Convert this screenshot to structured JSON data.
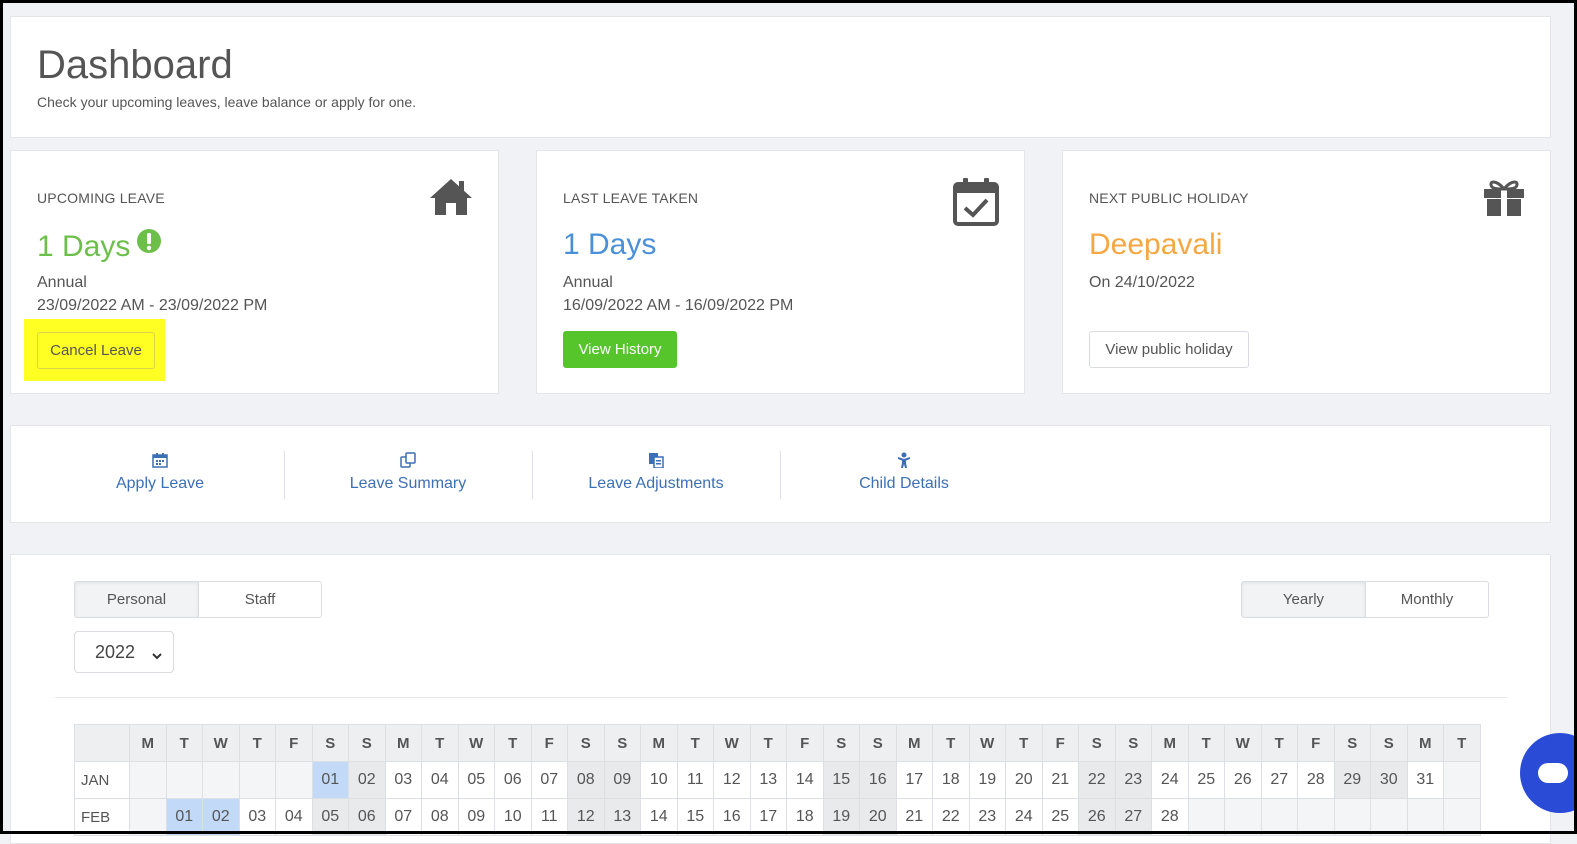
{
  "header": {
    "title": "Dashboard",
    "subtitle": "Check your upcoming leaves, leave balance or apply for one."
  },
  "cards": {
    "upcoming": {
      "label": "UPCOMING LEAVE",
      "value": "1 Days",
      "type": "Annual",
      "dates": "23/09/2022 AM - 23/09/2022 PM",
      "button": "Cancel Leave",
      "icon": "home-icon",
      "color": "#6cc04a"
    },
    "last": {
      "label": "LAST LEAVE TAKEN",
      "value": "1 Days",
      "type": "Annual",
      "dates": "16/09/2022 AM - 16/09/2022 PM",
      "button": "View History",
      "icon": "calendar-check-icon",
      "color": "#4a90d9"
    },
    "holiday": {
      "label": "NEXT PUBLIC HOLIDAY",
      "value": "Deepavali",
      "date": "On 24/10/2022",
      "button": "View public holiday",
      "icon": "gift-icon",
      "color": "#f5a742"
    }
  },
  "quick_links": [
    {
      "label": "Apply Leave",
      "icon": "calendar-icon"
    },
    {
      "label": "Leave Summary",
      "icon": "copy-icon"
    },
    {
      "label": "Leave Adjustments",
      "icon": "documents-icon"
    },
    {
      "label": "Child Details",
      "icon": "child-icon"
    }
  ],
  "calendar": {
    "view_toggle": [
      "Personal",
      "Staff"
    ],
    "period_toggle": [
      "Yearly",
      "Monthly"
    ],
    "year": "2022",
    "weekdays": [
      "M",
      "T",
      "W",
      "T",
      "F",
      "S",
      "S",
      "M",
      "T",
      "W",
      "T",
      "F",
      "S",
      "S",
      "M",
      "T",
      "W",
      "T",
      "F",
      "S",
      "S",
      "M",
      "T",
      "W",
      "T",
      "F",
      "S",
      "S",
      "M",
      "T",
      "W",
      "T",
      "F",
      "S",
      "S",
      "M",
      "T"
    ],
    "months": [
      {
        "name": "JAN",
        "start": 5,
        "days": 31,
        "highlight": [
          "01"
        ]
      },
      {
        "name": "FEB",
        "start": 1,
        "days": 28,
        "highlight": [
          "01",
          "02"
        ]
      }
    ]
  }
}
